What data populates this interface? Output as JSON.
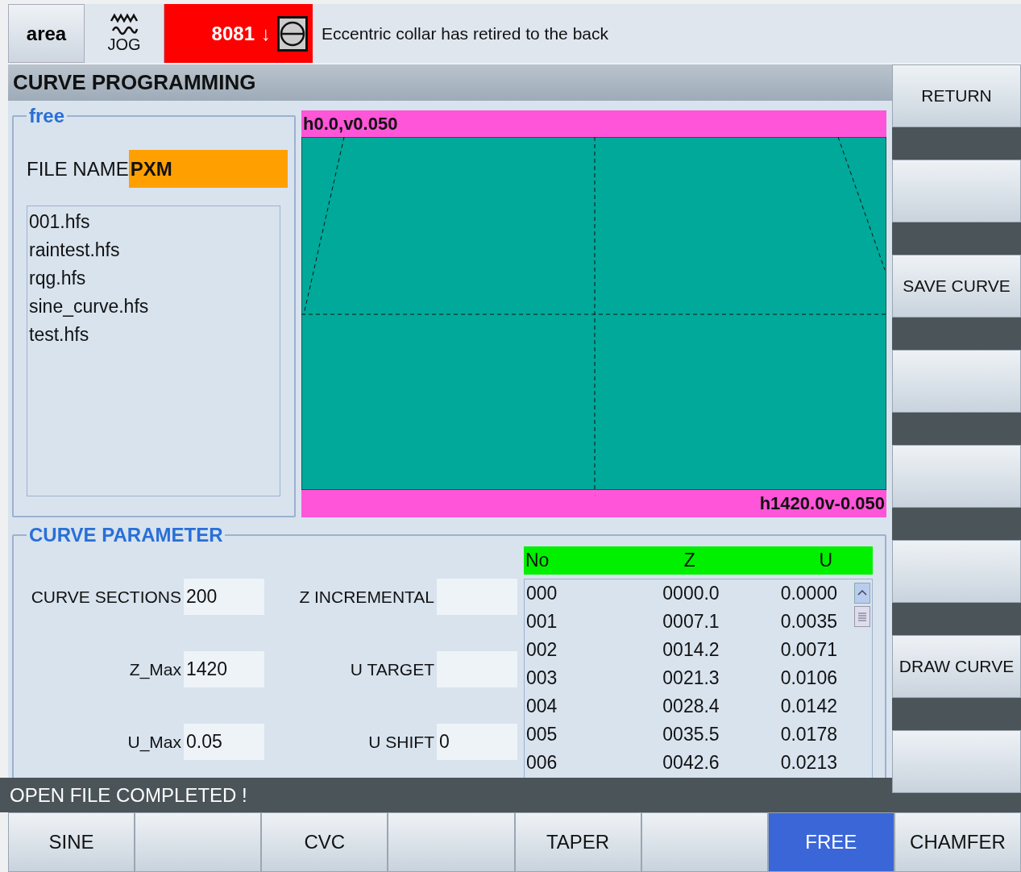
{
  "header": {
    "area_button": "area",
    "mode": "JOG",
    "alarm_number": "8081",
    "alarm_arrow": "↓",
    "message": "Eccentric collar has retired to the back"
  },
  "title": "CURVE PROGRAMMING",
  "free_panel": {
    "legend": "free",
    "file_name_label": "FILE NAME",
    "file_name_value": "PXM",
    "files": [
      "001.hfs",
      "raintest.hfs",
      "rqg.hfs",
      "sine_curve.hfs",
      "test.hfs"
    ]
  },
  "curve_view": {
    "top_label": "h0.0,v0.050",
    "bottom_label": "h1420.0v-0.050"
  },
  "parameters": {
    "legend": "CURVE PARAMETER",
    "fields": [
      {
        "label": "CURVE SECTIONS",
        "value": "200"
      },
      {
        "label": "Z INCREMENTAL"
      },
      {
        "label": "Z_Max",
        "value": "1420"
      },
      {
        "label": "U TARGET"
      },
      {
        "label": "U_Max",
        "value": "0.05"
      },
      {
        "label": "U SHIFT",
        "value": "0"
      }
    ],
    "table": {
      "columns": [
        "No",
        "Z",
        "U"
      ],
      "rows": [
        [
          "000",
          "0000.0",
          "0.0000"
        ],
        [
          "001",
          "0007.1",
          "0.0035"
        ],
        [
          "002",
          "0014.2",
          "0.0071"
        ],
        [
          "003",
          "0021.3",
          "0.0106"
        ],
        [
          "004",
          "0028.4",
          "0.0142"
        ],
        [
          "005",
          "0035.5",
          "0.0178"
        ],
        [
          "006",
          "0042.6",
          "0.0213"
        ]
      ]
    }
  },
  "status_bar": "OPEN FILE COMPLETED !",
  "softkeys_right": [
    {
      "kind": "labeled",
      "label": "RETURN"
    },
    {
      "kind": "blank"
    },
    {
      "kind": "labeled",
      "label": "SAVE CURVE"
    },
    {
      "kind": "blank"
    },
    {
      "kind": "blank"
    },
    {
      "kind": "blank"
    },
    {
      "kind": "labeled",
      "label": "DRAW CURVE"
    },
    {
      "kind": "blank"
    }
  ],
  "softkeys_bottom": [
    {
      "label": "SINE",
      "selected": false
    },
    {
      "selected": false
    },
    {
      "label": "CVC",
      "selected": false
    },
    {
      "selected": false
    },
    {
      "label": "TAPER",
      "selected": false
    },
    {
      "selected": false
    },
    {
      "label": "FREE",
      "selected": true
    },
    {
      "label": "CHAMFER",
      "selected": false
    }
  ]
}
